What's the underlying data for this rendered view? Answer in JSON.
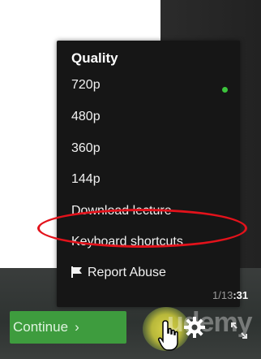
{
  "menu": {
    "title": "Quality",
    "items": [
      {
        "label": "720p",
        "selected": true
      },
      {
        "label": "480p"
      },
      {
        "label": "360p"
      },
      {
        "label": "144p"
      },
      {
        "label": "Download lecture",
        "highlighted": true
      },
      {
        "label": "Keyboard shortcuts"
      },
      {
        "label": "Report Abuse",
        "icon": "flag-icon"
      }
    ]
  },
  "player": {
    "continue_label": "Continue",
    "continue_chevron": "›",
    "time_faded": "1/13",
    "time_bold": ":31",
    "watermark": "udemy"
  },
  "colors": {
    "accent_green": "#3e9c3e",
    "selected_dot": "#3cc43c",
    "annotation_red": "#e3121b"
  }
}
